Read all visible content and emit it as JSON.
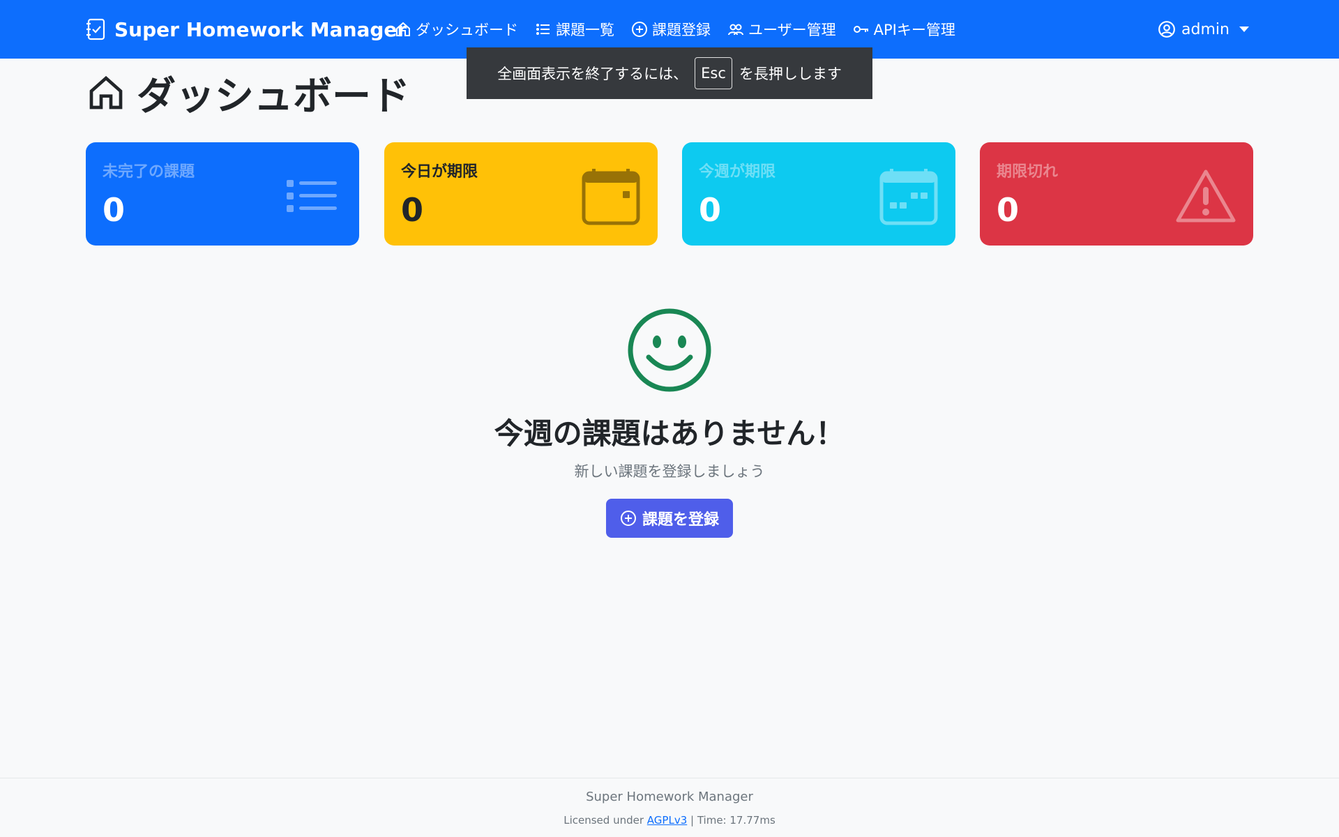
{
  "navbar": {
    "brand": "Super Homework Manager",
    "links": [
      {
        "label": "ダッシュボード",
        "icon": "house-icon"
      },
      {
        "label": "課題一覧",
        "icon": "list-icon"
      },
      {
        "label": "課題登録",
        "icon": "plus-circle-icon"
      },
      {
        "label": "ユーザー管理",
        "icon": "people-icon"
      },
      {
        "label": "APIキー管理",
        "icon": "key-icon"
      }
    ],
    "user": "admin"
  },
  "toast": {
    "before": "全画面表示を終了するには、",
    "key": "Esc",
    "after": "を長押しします"
  },
  "page": {
    "title": "ダッシュボード"
  },
  "cards": [
    {
      "label": "未完了の課題",
      "value": "0",
      "icon": "list-icon",
      "color": "#0d6efd"
    },
    {
      "label": "今日が期限",
      "value": "0",
      "icon": "calendar-icon",
      "color": "#ffc107"
    },
    {
      "label": "今週が期限",
      "value": "0",
      "icon": "calendar-week-icon",
      "color": "#0dcaf0"
    },
    {
      "label": "期限切れ",
      "value": "0",
      "icon": "warning-icon",
      "color": "#dc3545"
    }
  ],
  "empty_state": {
    "icon": "smile-icon",
    "title": "今週の課題はありません！",
    "subtitle": "新しい課題を登録しましょう",
    "button": "課題を登録"
  },
  "footer": {
    "name": "Super Homework Manager",
    "license_prefix": "Licensed under",
    "license_link": "AGPLv3",
    "time": "| Time: 17.77ms"
  }
}
